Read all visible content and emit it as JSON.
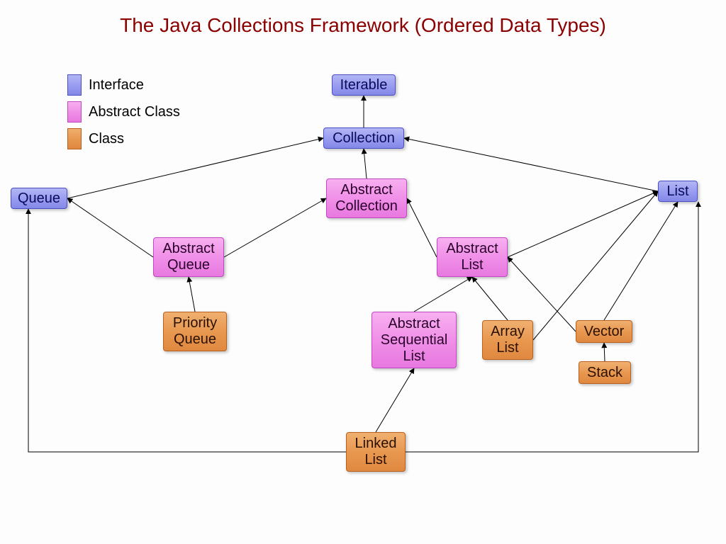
{
  "title": "The Java Collections Framework (Ordered Data Types)",
  "legend": {
    "interface": "Interface",
    "abstract": "Abstract Class",
    "class": "Class"
  },
  "colors": {
    "interface": "#9a9ef0",
    "abstract": "#f090e8",
    "class": "#e89850"
  },
  "nodes": {
    "iterable": {
      "label": "Iterable",
      "type": "interface"
    },
    "collection": {
      "label": "Collection",
      "type": "interface"
    },
    "queue": {
      "label": "Queue",
      "type": "interface"
    },
    "list": {
      "label": "List",
      "type": "interface"
    },
    "abscoll": {
      "label": "Abstract\nCollection",
      "type": "abstract"
    },
    "absqueue": {
      "label": "Abstract\nQueue",
      "type": "abstract"
    },
    "abslist": {
      "label": "Abstract\nList",
      "type": "abstract"
    },
    "absseqlist": {
      "label": "Abstract\nSequential\nList",
      "type": "abstract"
    },
    "pqueue": {
      "label": "Priority\nQueue",
      "type": "class"
    },
    "arraylist": {
      "label": "Array\nList",
      "type": "class"
    },
    "vector": {
      "label": "Vector",
      "type": "class"
    },
    "stack": {
      "label": "Stack",
      "type": "class"
    },
    "linkedlist": {
      "label": "Linked\nList",
      "type": "class"
    }
  },
  "edges": [
    [
      "collection",
      "iterable"
    ],
    [
      "queue",
      "collection"
    ],
    [
      "list",
      "collection"
    ],
    [
      "abscoll",
      "collection"
    ],
    [
      "absqueue",
      "queue"
    ],
    [
      "absqueue",
      "abscoll"
    ],
    [
      "abslist",
      "abscoll"
    ],
    [
      "abslist",
      "list"
    ],
    [
      "pqueue",
      "absqueue"
    ],
    [
      "absseqlist",
      "abslist"
    ],
    [
      "arraylist",
      "abslist"
    ],
    [
      "arraylist",
      "list"
    ],
    [
      "vector",
      "abslist"
    ],
    [
      "vector",
      "list"
    ],
    [
      "stack",
      "vector"
    ],
    [
      "linkedlist",
      "absseqlist"
    ],
    [
      "linkedlist",
      "queue"
    ],
    [
      "linkedlist",
      "list"
    ]
  ]
}
